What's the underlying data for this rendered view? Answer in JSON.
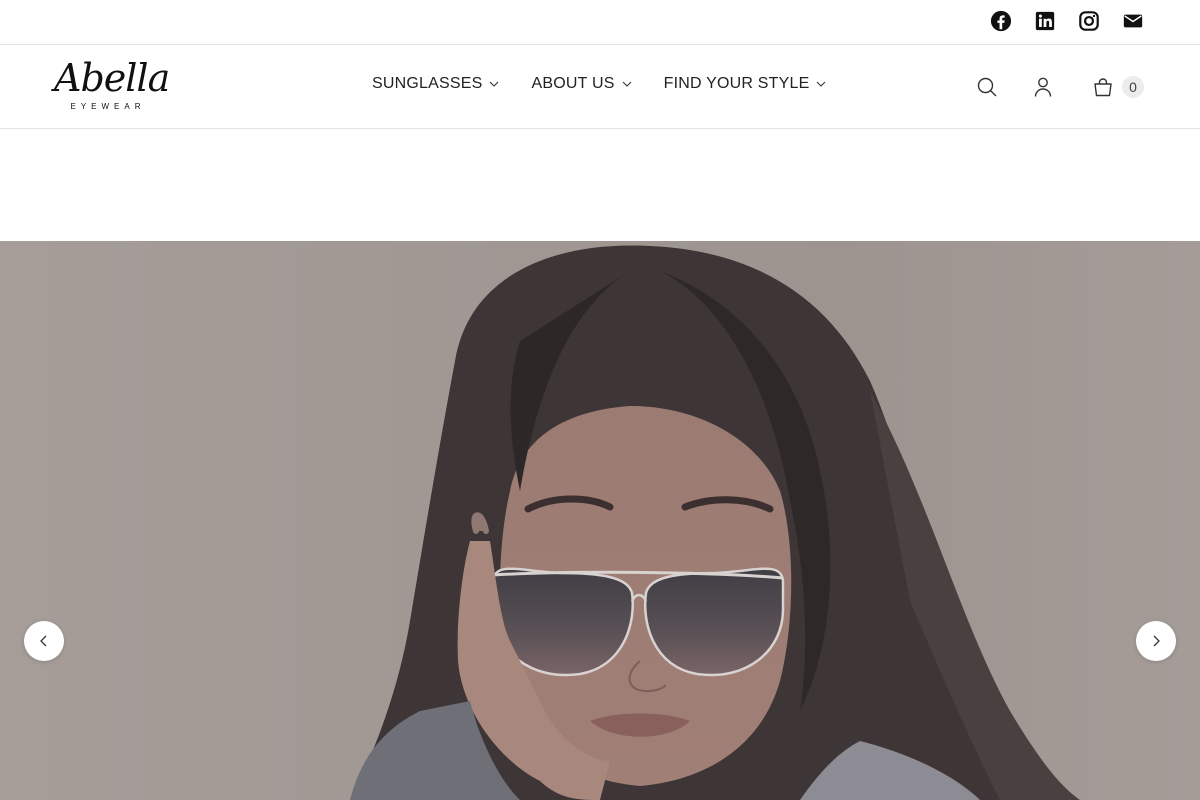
{
  "social": [
    {
      "name": "facebook-icon",
      "label": "Facebook"
    },
    {
      "name": "linkedin-icon",
      "label": "LinkedIn"
    },
    {
      "name": "instagram-icon",
      "label": "Instagram"
    },
    {
      "name": "email-icon",
      "label": "Email"
    }
  ],
  "logo": {
    "script": "Abella",
    "sub": "EYEWEAR"
  },
  "nav": {
    "items": [
      {
        "label": "SUNGLASSES"
      },
      {
        "label": "ABOUT US"
      },
      {
        "label": "FIND YOUR STYLE"
      }
    ]
  },
  "header": {
    "cart_count": "0"
  },
  "colors": {
    "text": "#222222",
    "border": "#e3e3e3",
    "badge_bg": "#ececec"
  }
}
